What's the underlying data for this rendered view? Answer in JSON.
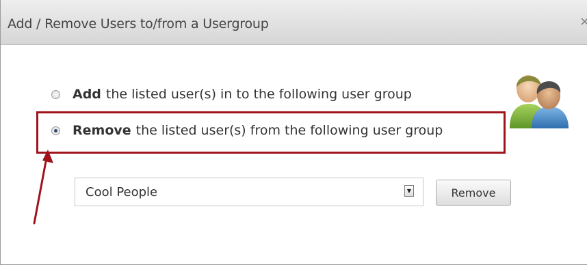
{
  "dialog": {
    "title": "Add / Remove Users to/from a Usergroup",
    "close_symbol": "×",
    "icon": "users-group-icon"
  },
  "options": {
    "add": {
      "bold": "Add",
      "text": "the listed user(s) in to the following user group",
      "selected": false
    },
    "remove": {
      "bold": "Remove",
      "text": "the listed user(s) from the following user group",
      "selected": true
    }
  },
  "group_select": {
    "value": "Cool People"
  },
  "remove_button": {
    "label": "Remove"
  },
  "annotation": {
    "color": "#a0121c",
    "icon": "arrow-annotation-icon"
  }
}
